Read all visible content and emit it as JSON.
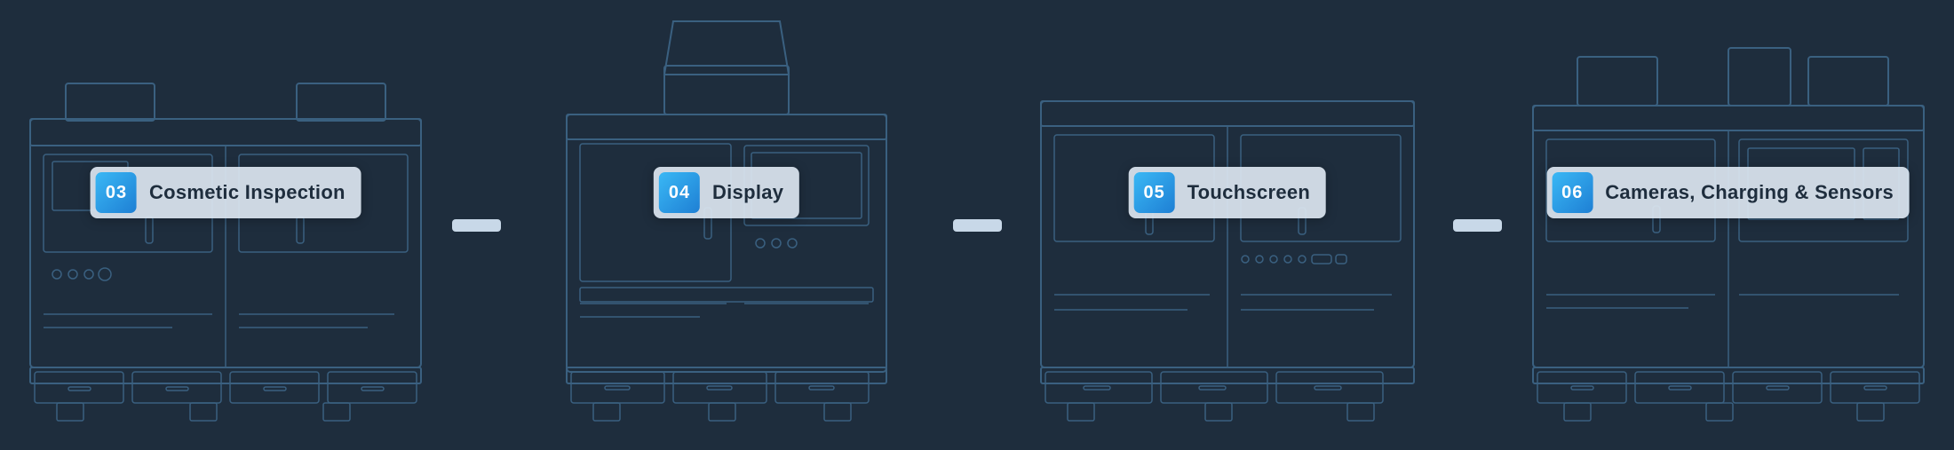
{
  "bg_color": "#1e2d3d",
  "accent_color": "#3ab8f5",
  "connector_color": "#c8d8e8",
  "machines": [
    {
      "id": "machine-03",
      "number": "03",
      "label": "Cosmetic Inspection",
      "type": "wide-cabinet"
    },
    {
      "id": "machine-04",
      "number": "04",
      "label": "Display",
      "type": "tower"
    },
    {
      "id": "machine-05",
      "number": "05",
      "label": "Touchscreen",
      "type": "wide-panel"
    },
    {
      "id": "machine-06",
      "number": "06",
      "label": "Cameras, Charging & Sensors",
      "type": "tall-cabinet"
    }
  ],
  "connectors": 3
}
